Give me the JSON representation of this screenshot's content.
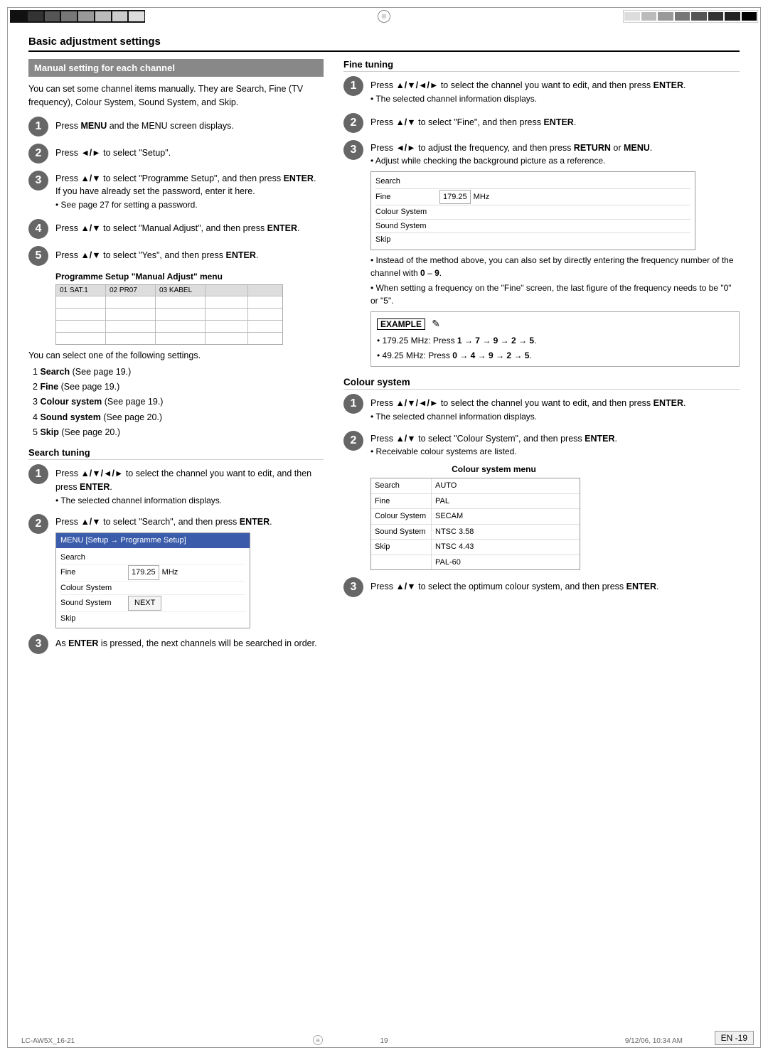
{
  "page": {
    "title": "Basic adjustment settings",
    "section_manual": "Manual setting for each channel",
    "intro": "You can set some channel items manually. They are Search, Fine (TV frequency), Colour System, Sound System, and Skip.",
    "steps_left": [
      {
        "num": "1",
        "text": "Press ",
        "bold": "MENU",
        "rest": " and the MENU screen displays."
      },
      {
        "num": "2",
        "text": "Press ",
        "arrow": "◄/►",
        "rest": " to select \"Setup\"."
      },
      {
        "num": "3",
        "text": "Press ",
        "arrow": "▲/▼",
        "rest1": " to select \"Programme Setup\", and then press ",
        "bold2": "ENTER",
        "rest2": ".\nIf you have already set the password, enter it here.",
        "bullet": "See page 27 for setting a password."
      },
      {
        "num": "4",
        "text": "Press ",
        "arrow": "▲/▼",
        "rest1": " to select \"Manual Adjust\", and then press ",
        "bold": "ENTER",
        "rest2": "."
      },
      {
        "num": "5",
        "text": "Press ",
        "arrow": "▲/▼",
        "rest1": " to select \"Yes\", and then press ",
        "bold": "ENTER",
        "rest2": "."
      }
    ],
    "prog_setup_heading": "Programme Setup \"Manual Adjust\" menu",
    "prog_table_headers": [
      "01 SAT.1",
      "02 PR07",
      "03 KABEL",
      "",
      ""
    ],
    "following_text": "You can select one of the following settings.",
    "list_items": [
      {
        "num": "1",
        "bold": "Search",
        "rest": " (See page 19.)"
      },
      {
        "num": "2",
        "bold": "Fine",
        "rest": " (See page 19.)"
      },
      {
        "num": "3",
        "bold": "Colour system",
        "rest": " (See page 19.)"
      },
      {
        "num": "4",
        "bold": "Sound system",
        "rest": " (See page 20.)"
      },
      {
        "num": "5",
        "bold": "Skip",
        "rest": " (See page 20.)"
      }
    ],
    "search_tuning_heading": "Search tuning",
    "search_steps": [
      {
        "num": "1",
        "arrow": "▲/▼/◄/►",
        "text1": " to select the channel you want to edit, and then press ",
        "bold": "ENTER",
        "text2": ".",
        "bullet": "The selected channel information displays."
      },
      {
        "num": "2",
        "text1": "Press ",
        "arrow": "▲/▼",
        "text2": " to select \"Search\", and then press ",
        "bold": "ENTER",
        "text3": ".",
        "menu_bar": "MENU   [Setup → Programme Setup]",
        "table_rows": [
          {
            "label": "Search",
            "value": "",
            "unit": ""
          },
          {
            "label": "Fine",
            "value": "179.25",
            "unit": "MHz"
          },
          {
            "label": "Colour System",
            "value": "",
            "unit": ""
          },
          {
            "label": "Sound System",
            "value": "",
            "unit": ""
          },
          {
            "label": "Skip",
            "value": "NEXT",
            "unit": "btn"
          }
        ]
      },
      {
        "num": "3",
        "text1": "As ",
        "bold": "ENTER",
        "text2": " is pressed, the next channels will be searched in order."
      }
    ],
    "fine_tuning_heading": "Fine tuning",
    "fine_steps": [
      {
        "num": "1",
        "text1": "Press ",
        "arrow": "▲/▼/◄/►",
        "text2": " to select the channel you want to edit, and then press ",
        "bold": "ENTER",
        "text3": ".",
        "bullet": "The selected channel information displays."
      },
      {
        "num": "2",
        "text1": "Press ",
        "arrow": "▲/▼",
        "text2": " to select \"Fine\", and then press ",
        "bold": "ENTER",
        "text3": "."
      },
      {
        "num": "3",
        "text1": "Press ",
        "arrow": "◄/►",
        "text2": " to adjust the frequency, and then press ",
        "bold1": "RETURN",
        "text3": " or ",
        "bold2": "MENU",
        "text4": ".",
        "bullet": "Adjust while checking the background picture as a reference.",
        "table_rows": [
          {
            "label": "Search",
            "value": "",
            "unit": ""
          },
          {
            "label": "Fine",
            "value": "179.25",
            "unit": "MHz"
          },
          {
            "label": "Colour System",
            "value": "",
            "unit": ""
          },
          {
            "label": "Sound System",
            "value": "",
            "unit": ""
          },
          {
            "label": "Skip",
            "value": "",
            "unit": ""
          }
        ],
        "bullet2": "Instead of the method above, you can also set by directly entering the frequency number of the channel with 0 – 9.",
        "bullet3": "When setting a frequency on the \"Fine\" screen, the last figure of the frequency needs to be \"0\" or \"5\".",
        "example_label": "EXAMPLE",
        "example_lines": [
          "• 179.25 MHz: Press 1 → 7 → 9 → 2 → 5.",
          "• 49.25 MHz: Press 0 → 4 → 9 → 2 → 5."
        ]
      }
    ],
    "colour_system_heading": "Colour system",
    "colour_steps": [
      {
        "num": "1",
        "text1": "Press ",
        "arrow": "▲/▼/◄/►",
        "text2": " to select the channel you want to edit, and then press ",
        "bold": "ENTER",
        "text3": ".",
        "bullet": "The selected channel information displays."
      },
      {
        "num": "2",
        "text1": "Press ",
        "arrow": "▲/▼",
        "text2": " to select \"Colour System\", and then press ",
        "bold": "ENTER",
        "text3": ".",
        "bullet": "Receivable colour systems are listed.",
        "sub_heading": "Colour system menu",
        "csys_table": [
          {
            "left": "Search",
            "right": "AUTO"
          },
          {
            "left": "Fine",
            "right": "PAL"
          },
          {
            "left": "Colour System",
            "right": "SECAM"
          },
          {
            "left": "Sound System",
            "right": "NTSC 3.58"
          },
          {
            "left": "Skip",
            "right": "NTSC 4.43"
          },
          {
            "left": "",
            "right": "PAL-60"
          }
        ]
      },
      {
        "num": "3",
        "text1": "Press ",
        "arrow": "▲/▼",
        "text2": " to select the optimum colour system, and then press ",
        "bold": "ENTER",
        "text3": "."
      }
    ],
    "footer": {
      "left": "LC-AW5X_16-21",
      "center": "19",
      "right": "9/12/06, 10:34 AM"
    },
    "page_num": "EN -19"
  }
}
